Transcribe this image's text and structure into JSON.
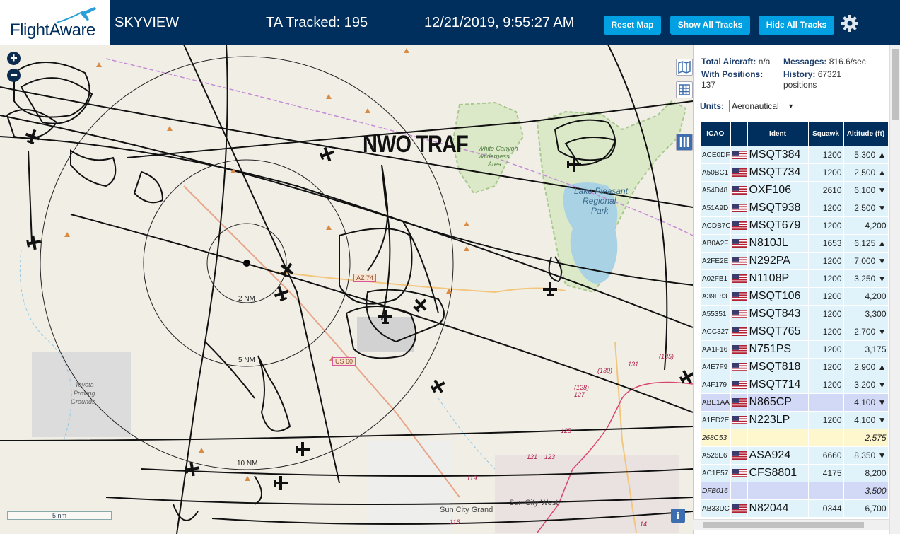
{
  "header": {
    "logo_text": "FlightAware",
    "app_title": "SKYVIEW",
    "tracked": "TA Tracked: 195",
    "datetime": "12/21/2019, 9:55:27 AM",
    "reset_map": "Reset Map",
    "show_all_tracks": "Show All Tracks",
    "hide_all_tracks": "Hide All Tracks"
  },
  "map": {
    "overlay_title": "NWO TRAF",
    "ring_labels": [
      "2 NM",
      "5 NM",
      "10 NM"
    ],
    "places": [
      "Lake Pleasant",
      "Regional",
      "Park",
      "Toyota",
      "Proving",
      "Grounds",
      "Sun City West",
      "Sun City Grand",
      "White Canyon",
      "Wilderness",
      "Area"
    ],
    "road_labels": [
      "AZ 74",
      "US 60"
    ],
    "route_labels": [
      "131",
      "(135)",
      "(130)",
      "(128)",
      "127",
      "125",
      "123",
      "121",
      "119",
      "116",
      "14"
    ],
    "scale": "5 nm",
    "zoom_in": "+",
    "zoom_out": "−",
    "info": "i"
  },
  "stats": {
    "total_label": "Total Aircraft:",
    "total_value": "n/a",
    "messages_label": "Messages:",
    "messages_value": "816.6/sec",
    "positions_label": "With Positions:",
    "positions_value": "137",
    "history_label": "History:",
    "history_value": "67321 positions"
  },
  "units": {
    "label": "Units:",
    "selected": "Aeronautical"
  },
  "table": {
    "headers": [
      "ICAO",
      "Ident",
      "Squawk",
      "Altitude (ft)"
    ],
    "rows": [
      {
        "icao": "ACE0DF",
        "ident": "MSQT384",
        "squawk": "1200",
        "alt": "5,300 ▲",
        "style": "normal"
      },
      {
        "icao": "A50BC1",
        "ident": "MSQT734",
        "squawk": "1200",
        "alt": "2,500 ▲",
        "style": "normal"
      },
      {
        "icao": "A54D48",
        "ident": "OXF106",
        "squawk": "2610",
        "alt": "6,100 ▼",
        "style": "normal"
      },
      {
        "icao": "A51A9D",
        "ident": "MSQT938",
        "squawk": "1200",
        "alt": "2,500 ▼",
        "style": "normal"
      },
      {
        "icao": "ACDB7C",
        "ident": "MSQT679",
        "squawk": "1200",
        "alt": "4,200",
        "style": "normal"
      },
      {
        "icao": "AB0A2F",
        "ident": "N810JL",
        "squawk": "1653",
        "alt": "6,125 ▲",
        "style": "normal"
      },
      {
        "icao": "A2FE2E",
        "ident": "N292PA",
        "squawk": "1200",
        "alt": "7,000 ▼",
        "style": "normal"
      },
      {
        "icao": "A02FB1",
        "ident": "N1108P",
        "squawk": "1200",
        "alt": "3,250 ▼",
        "style": "normal"
      },
      {
        "icao": "A39E83",
        "ident": "MSQT106",
        "squawk": "1200",
        "alt": "4,200",
        "style": "normal"
      },
      {
        "icao": "A55351",
        "ident": "MSQT843",
        "squawk": "1200",
        "alt": "3,300",
        "style": "normal"
      },
      {
        "icao": "ACC327",
        "ident": "MSQT765",
        "squawk": "1200",
        "alt": "2,700 ▼",
        "style": "normal"
      },
      {
        "icao": "AA1F16",
        "ident": "N751PS",
        "squawk": "1200",
        "alt": "3,175",
        "style": "normal"
      },
      {
        "icao": "A4E7F9",
        "ident": "MSQT818",
        "squawk": "1200",
        "alt": "2,900 ▲",
        "style": "normal"
      },
      {
        "icao": "A4F179",
        "ident": "MSQT714",
        "squawk": "1200",
        "alt": "3,200 ▼",
        "style": "normal"
      },
      {
        "icao": "ABE1AA",
        "ident": "N865CP",
        "squawk": "",
        "alt": "4,100 ▼",
        "style": "mlat"
      },
      {
        "icao": "A1ED2E",
        "ident": "N223LP",
        "squawk": "1200",
        "alt": "4,100 ▼",
        "style": "normal"
      },
      {
        "icao": "268C53",
        "ident": "",
        "squawk": "",
        "alt": "2,575",
        "style": "noflag"
      },
      {
        "icao": "A526E6",
        "ident": "ASA924",
        "squawk": "6660",
        "alt": "8,350 ▼",
        "style": "normal"
      },
      {
        "icao": "AC1E57",
        "ident": "CFS8801",
        "squawk": "4175",
        "alt": "8,200",
        "style": "normal"
      },
      {
        "icao": "DFB016",
        "ident": "",
        "squawk": "",
        "alt": "3,500",
        "style": "mlatnoident"
      },
      {
        "icao": "AB33DC",
        "ident": "N82044",
        "squawk": "0344",
        "alt": "6,700",
        "style": "normal"
      }
    ]
  },
  "colors": {
    "header_bg": "#002f5d",
    "button": "#00a0e2",
    "row": "#e0f3fb",
    "row_mlat": "#d2d9f7",
    "row_noflag": "#fef6cc"
  }
}
